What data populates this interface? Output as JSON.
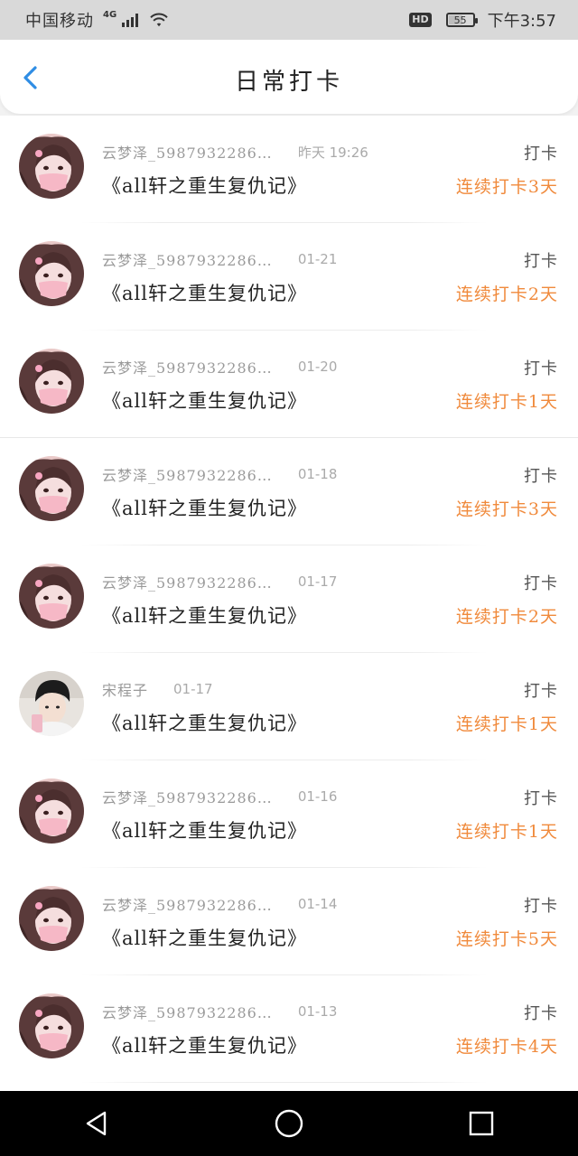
{
  "status_bar": {
    "carrier": "中国移动",
    "network_type": "4G",
    "hd_label": "HD",
    "battery_level": "55",
    "time": "下午3:57",
    "icons": [
      "signal-icon",
      "wifi-icon",
      "hd-icon",
      "battery-icon"
    ]
  },
  "header": {
    "title": "日常打卡",
    "back_icon": "back-chevron-icon",
    "accent_color": "#2f8de4"
  },
  "colors": {
    "streak": "#f08a3c",
    "meta": "#9a9a9a",
    "book": "#222222"
  },
  "items": [
    {
      "name": "云梦泽_5987932286…",
      "date": "昨天  19:26",
      "book": "《all轩之重生复仇记》",
      "action": "打卡",
      "streak": "连续打卡3天",
      "avatar": "girl-avatar"
    },
    {
      "name": "云梦泽_5987932286…",
      "date": "01-21",
      "book": "《all轩之重生复仇记》",
      "action": "打卡",
      "streak": "连续打卡2天",
      "avatar": "girl-avatar"
    },
    {
      "name": "云梦泽_5987932286…",
      "date": "01-20",
      "book": "《all轩之重生复仇记》",
      "action": "打卡",
      "streak": "连续打卡1天",
      "avatar": "girl-avatar"
    },
    {
      "name": "云梦泽_5987932286…",
      "date": "01-18",
      "book": "《all轩之重生复仇记》",
      "action": "打卡",
      "streak": "连续打卡3天",
      "avatar": "girl-avatar"
    },
    {
      "name": "云梦泽_5987932286…",
      "date": "01-17",
      "book": "《all轩之重生复仇记》",
      "action": "打卡",
      "streak": "连续打卡2天",
      "avatar": "girl-avatar"
    },
    {
      "name": "宋程子",
      "date": "01-17",
      "book": "《all轩之重生复仇记》",
      "action": "打卡",
      "streak": "连续打卡1天",
      "avatar": "boy-avatar"
    },
    {
      "name": "云梦泽_5987932286…",
      "date": "01-16",
      "book": "《all轩之重生复仇记》",
      "action": "打卡",
      "streak": "连续打卡1天",
      "avatar": "girl-avatar"
    },
    {
      "name": "云梦泽_5987932286…",
      "date": "01-14",
      "book": "《all轩之重生复仇记》",
      "action": "打卡",
      "streak": "连续打卡5天",
      "avatar": "girl-avatar"
    },
    {
      "name": "云梦泽_5987932286…",
      "date": "01-13",
      "book": "《all轩之重生复仇记》",
      "action": "打卡",
      "streak": "连续打卡4天",
      "avatar": "girl-avatar"
    }
  ],
  "nav_bar": {
    "buttons": [
      "back-triangle-icon",
      "home-circle-icon",
      "recents-square-icon"
    ]
  }
}
